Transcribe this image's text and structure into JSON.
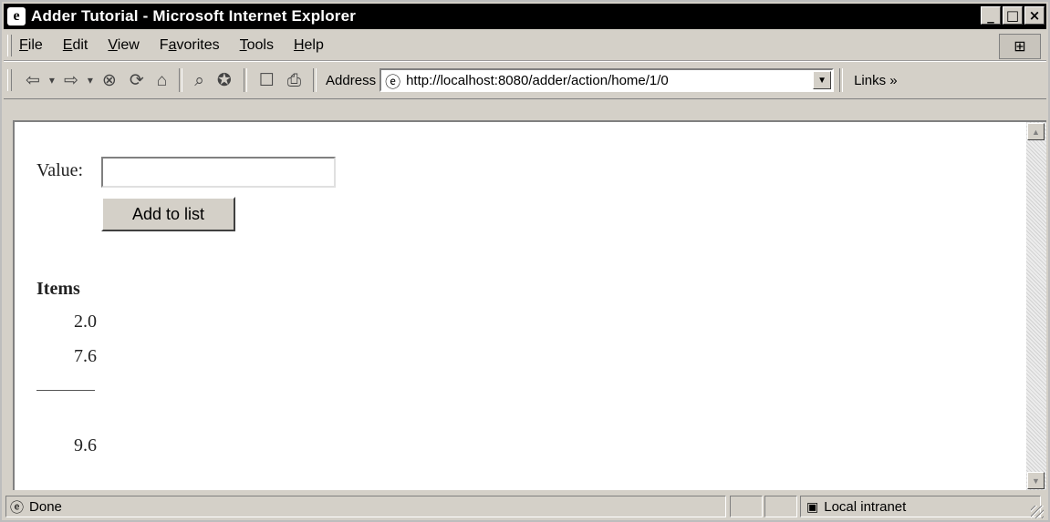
{
  "window": {
    "title": "Adder Tutorial - Microsoft Internet Explorer",
    "minimize": "_",
    "maximize": "□",
    "close": "×"
  },
  "menu": {
    "items": [
      {
        "key": "F",
        "rest": "ile"
      },
      {
        "key": "E",
        "rest": "dit"
      },
      {
        "key": "V",
        "rest": "iew"
      },
      {
        "pre": "F",
        "key": "a",
        "rest": "vorites"
      },
      {
        "key": "T",
        "rest": "ools"
      },
      {
        "key": "H",
        "rest": "elp"
      }
    ]
  },
  "toolbar": {
    "address_label": "Address",
    "address_url": "http://localhost:8080/adder/action/home/1/0",
    "links_label": "Links »"
  },
  "form": {
    "value_label": "Value:",
    "value_input": "",
    "add_button": "Add to list"
  },
  "items": {
    "header": "Items",
    "values": [
      "2.0",
      "7.6"
    ],
    "total": "9.6"
  },
  "status": {
    "text": "Done",
    "zone": "Local intranet"
  }
}
